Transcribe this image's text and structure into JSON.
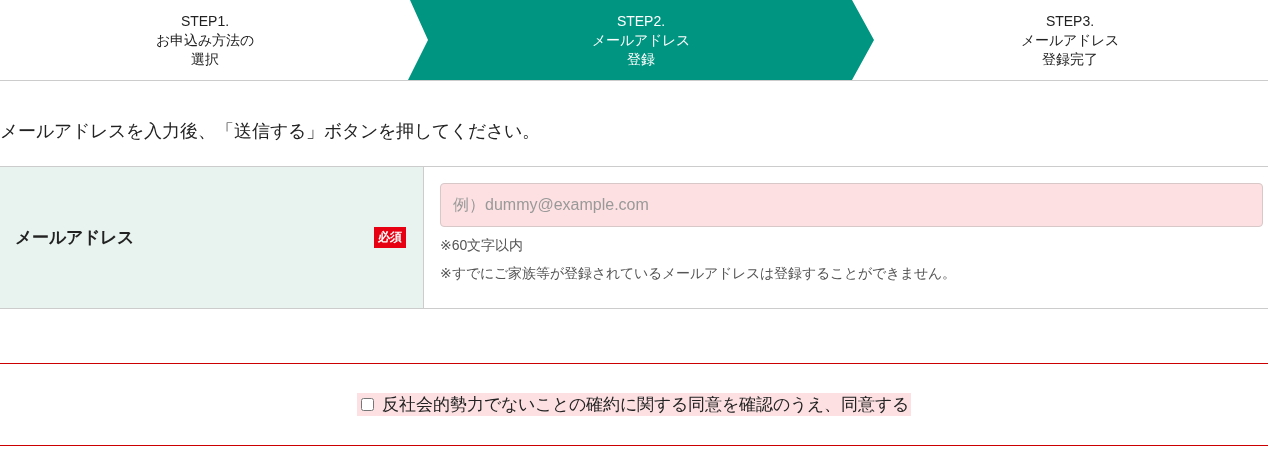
{
  "steps": [
    {
      "lines": [
        "STEP1.",
        "お申込み方法の",
        "選択"
      ],
      "selected": false
    },
    {
      "lines": [
        "STEP2.",
        "メールアドレス",
        "登録"
      ],
      "selected": true
    },
    {
      "lines": [
        "STEP3.",
        "メールアドレス",
        "登録完了"
      ],
      "selected": false
    }
  ],
  "instruction": "メールアドレスを入力後、「送信する」ボタンを押してください。",
  "form": {
    "label": "メールアドレス",
    "required_badge": "必須",
    "placeholder": "例）dummy@example.com",
    "notes": [
      "※60文字以内",
      "※すでにご家族等が登録されているメールアドレスは登録することができません。"
    ]
  },
  "agreement": {
    "label": "反社会的勢力でないことの確約に関する同意を確認のうえ、同意する",
    "checked": false
  }
}
